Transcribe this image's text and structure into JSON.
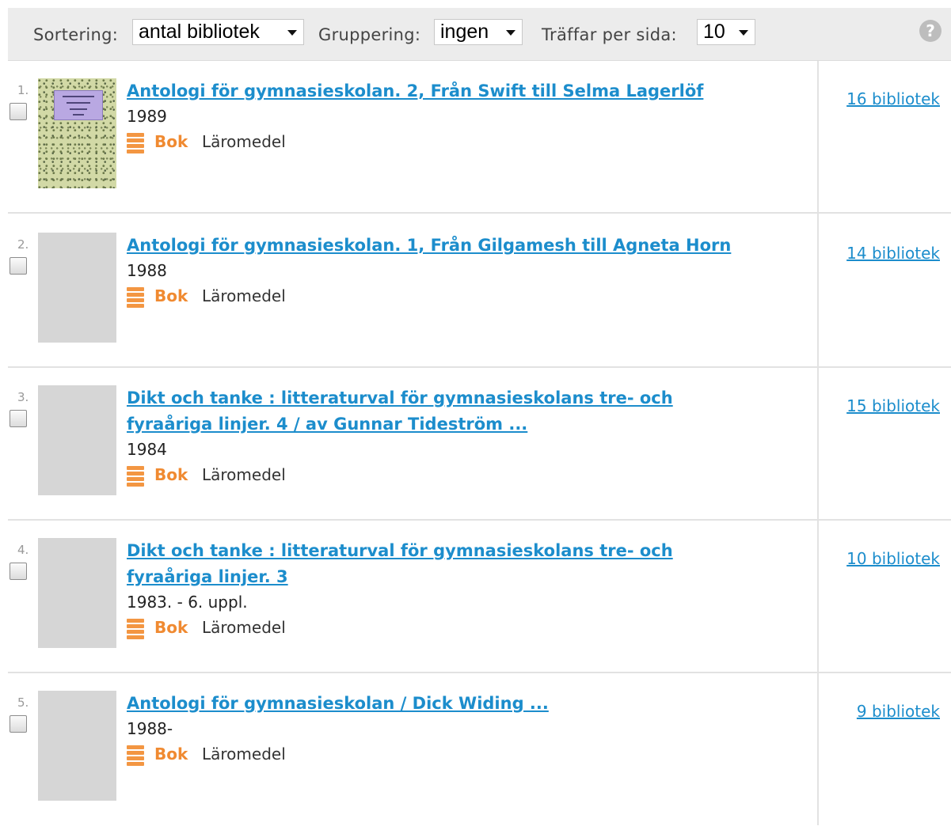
{
  "toolbar": {
    "sort_label": "Sortering:",
    "sort_value": "antal bibliotek",
    "group_label": "Gruppering:",
    "group_value": "ingen",
    "perpage_label": "Träffar per sida:",
    "perpage_value": "10",
    "help_icon": "help-circle-icon",
    "help_glyph": "?"
  },
  "colors": {
    "link": "#1c8dcc",
    "type_accent": "#f08a31",
    "toolbar_bg": "#ececec"
  },
  "results": [
    {
      "number": "1.",
      "title_lines": [
        "Antologi för gymnasieskolan. 2, Från Swift till Selma Lagerlöf"
      ],
      "year": "1989",
      "type": "Bok",
      "subtype": "Läromedel",
      "libraries": "16 bibliotek",
      "has_cover": true
    },
    {
      "number": "2.",
      "title_lines": [
        "Antologi för gymnasieskolan. 1, Från Gilgamesh till Agneta Horn"
      ],
      "year": "1988",
      "type": "Bok",
      "subtype": "Läromedel",
      "libraries": "14 bibliotek",
      "has_cover": false
    },
    {
      "number": "3.",
      "title_lines": [
        "Dikt och tanke : litteraturval för gymnasieskolans tre- och",
        "fyraåriga linjer. 4 / av Gunnar Tideström ..."
      ],
      "year": "1984",
      "type": "Bok",
      "subtype": "Läromedel",
      "libraries": "15 bibliotek",
      "has_cover": false
    },
    {
      "number": "4.",
      "title_lines": [
        "Dikt och tanke : litteraturval för gymnasieskolans tre- och",
        "fyraåriga linjer. 3"
      ],
      "year": "1983. - 6. uppl.",
      "type": "Bok",
      "subtype": "Läromedel",
      "libraries": "10 bibliotek",
      "has_cover": false
    },
    {
      "number": "5.",
      "title_lines": [
        "Antologi för gymnasieskolan / Dick Widing ..."
      ],
      "year": "1988-",
      "type": "Bok",
      "subtype": "Läromedel",
      "libraries": "9 bibliotek",
      "has_cover": false
    }
  ]
}
